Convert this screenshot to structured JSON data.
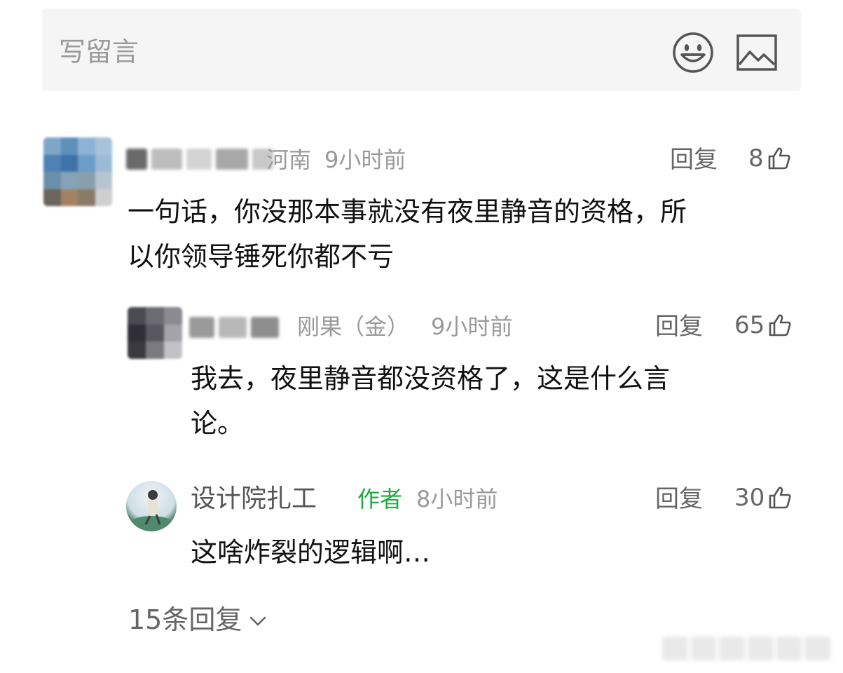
{
  "compose": {
    "placeholder": "写留言",
    "emoji_icon": "smiley-face-icon",
    "image_icon": "image-icon"
  },
  "comments": [
    {
      "location": "河南",
      "time": "9小时前",
      "reply_label": "回复",
      "likes": "8",
      "text_line1": "一句话，你没那本事就没有夜里静音的资格，所",
      "text_line2": "以你领导锤死你都不亏"
    }
  ],
  "replies": [
    {
      "badge": "刚果（金）",
      "time": "9小时前",
      "reply_label": "回复",
      "likes": "65",
      "text_line1": "我去，夜里静音都没资格了，这是什么言",
      "text_line2": "论。"
    },
    {
      "name": "设计院扎工",
      "author_tag": "作者",
      "time": "8小时前",
      "reply_label": "回复",
      "likes": "30",
      "text_line1": "这啥炸裂的逻辑啊…"
    }
  ],
  "more_replies": {
    "label": "15条回复"
  },
  "colors": {
    "accent_green": "#1aad3c",
    "muted_text": "#9a9a9a",
    "compose_bg": "#f5f5f5"
  }
}
